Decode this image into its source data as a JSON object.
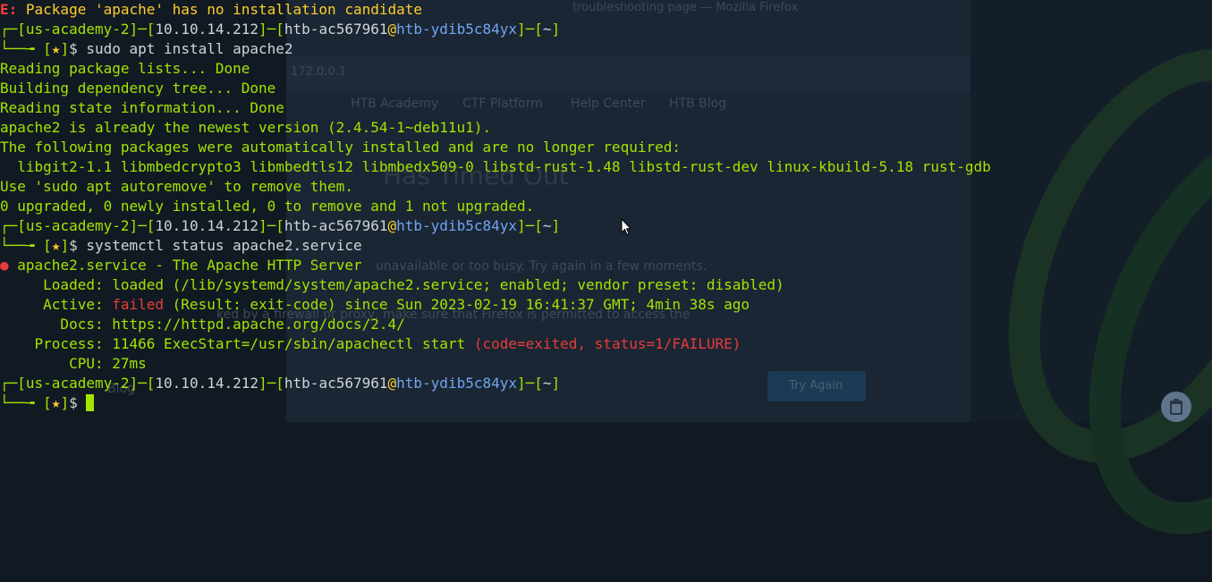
{
  "background": {
    "items": [
      {
        "text": "troubleshooting page — Mozilla Firefox"
      },
      {
        "text": "172.0.0.1"
      },
      {
        "text": "HTB Academy"
      },
      {
        "text": "CTF Platform"
      },
      {
        "text": "Help Center"
      },
      {
        "text": "HTB Blog"
      },
      {
        "text": "Has Timed Out"
      },
      {
        "text": "unavailable or too busy. Try again in a few moments."
      },
      {
        "text": "ked by a firewall or proxy, make sure that Firefox is permitted to access the"
      },
      {
        "text": "Try Again"
      },
      {
        "text": "Blog"
      }
    ]
  },
  "prompt": {
    "user_box": "us-academy-2",
    "ip_box": "10.10.14.212",
    "user": "htb-ac567961",
    "at": "@",
    "host": "htb-ydib5c84yx",
    "dir_box": "~",
    "star": "★",
    "dollar": "$"
  },
  "terminal": {
    "error_prefix": "E:",
    "error_text": " Package 'apache' has no installation candidate",
    "cmd1": " sudo apt install apache2",
    "out1": [
      "Reading package lists... Done",
      "Building dependency tree... Done",
      "Reading state information... Done",
      "apache2 is already the newest version (2.4.54-1~deb11u1).",
      "The following packages were automatically installed and are no longer required:",
      "  libgit2-1.1 libmbedcrypto3 libmbedtls12 libmbedx509-0 libstd-rust-1.48 libstd-rust-dev linux-kbuild-5.18 rust-gdb",
      "Use 'sudo apt autoremove' to remove them.",
      "0 upgraded, 0 newly installed, 0 to remove and 1 not upgraded."
    ],
    "cmd2": " systemctl status apache2.service",
    "service_dot": "●",
    "service_line": " apache2.service - The Apache HTTP Server",
    "loaded": "     Loaded: loaded (/lib/systemd/system/apache2.service; enabled; vendor preset: disabled)",
    "active_label": "     Active: ",
    "active_state": "failed",
    "active_rest": " (Result: exit-code) since Sun 2023-02-19 16:41:37 GMT; 4min 38s ago",
    "docs": "       Docs: https://httpd.apache.org/docs/2.4/",
    "process_label": "    Process: 11466 ExecStart=/usr/sbin/apachectl start ",
    "process_status": "(code=exited, status=1/FAILURE)",
    "cpu": "        CPU: 27ms"
  },
  "colors": {
    "prompt_green": "#a4e400",
    "error_red": "#e93b3b",
    "host_blue": "#6fa6f2",
    "background": "#111a23"
  },
  "icons": {
    "tray": "clipboard-icon",
    "pointer": "mouse-pointer-icon"
  }
}
